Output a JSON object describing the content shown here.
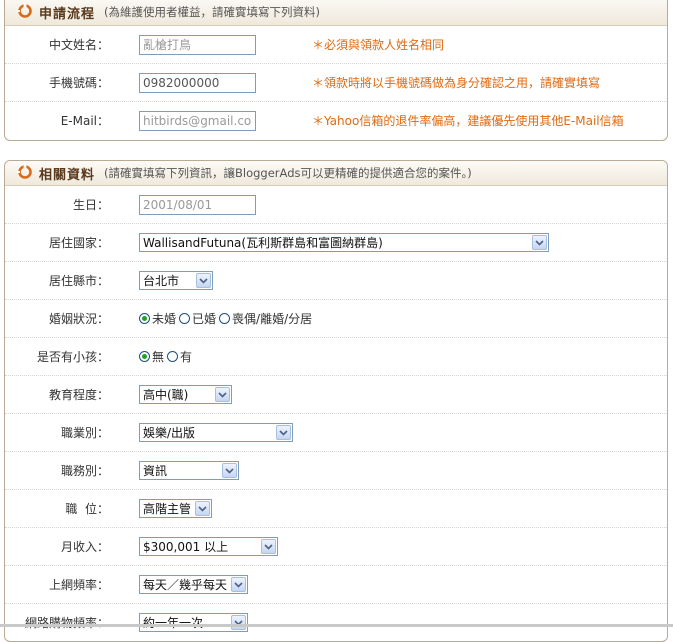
{
  "apply": {
    "title": "申請流程",
    "note": "(為維護使用者權益，請確實填寫下列資料)",
    "fields": [
      {
        "label": "中文姓名：",
        "value": "亂槍打鳥",
        "hint": "＊必須與領款人姓名相同"
      },
      {
        "label": "手機號碼：",
        "value": "0982000000",
        "hint": "＊領款時將以手機號碼做為身分確認之用，請確實填寫"
      },
      {
        "label": "E-Mail：",
        "value": "hitbirds@gmail.com",
        "hint": "＊Yahoo信箱的退件率偏高，建議優先使用其他E-Mail信箱"
      }
    ]
  },
  "profile": {
    "title": "相關資料",
    "note": "(請確實填寫下列資訊，讓BloggerAds可以更精確的提供適合您的案件。)",
    "birthday": {
      "label": "生日：",
      "value": "2001/08/01"
    },
    "country": {
      "label": "居住國家：",
      "value": "WallisandFutuna(瓦利斯群島和富圖納群島)"
    },
    "city": {
      "label": "居住縣市：",
      "value": "台北市"
    },
    "marital": {
      "label": "婚姻狀況：",
      "options": [
        "未婚",
        "已婚",
        "喪偶/離婚/分居"
      ],
      "selected": 0
    },
    "children": {
      "label": "是否有小孩：",
      "options": [
        "無",
        "有"
      ],
      "selected": 0
    },
    "education": {
      "label": "教育程度：",
      "value": "高中(職)"
    },
    "occupation": {
      "label": "職業別：",
      "value": "娛樂/出版"
    },
    "job_type": {
      "label": "職務別：",
      "value": "資訊"
    },
    "position": {
      "label": "職  位：",
      "value": "高階主管"
    },
    "income": {
      "label": "月收入：",
      "value": "$300,001 以上"
    },
    "online_freq": {
      "label": "上網頻率：",
      "value": "每天／幾乎每天"
    },
    "shopping_freq": {
      "label": "網路購物頻率：",
      "value": "約一年一次"
    }
  },
  "colors": {
    "hint": "#e06a10",
    "logo": "#d86a1a",
    "panel_border": "#b8aa94",
    "radio_dot": "#21a121"
  }
}
